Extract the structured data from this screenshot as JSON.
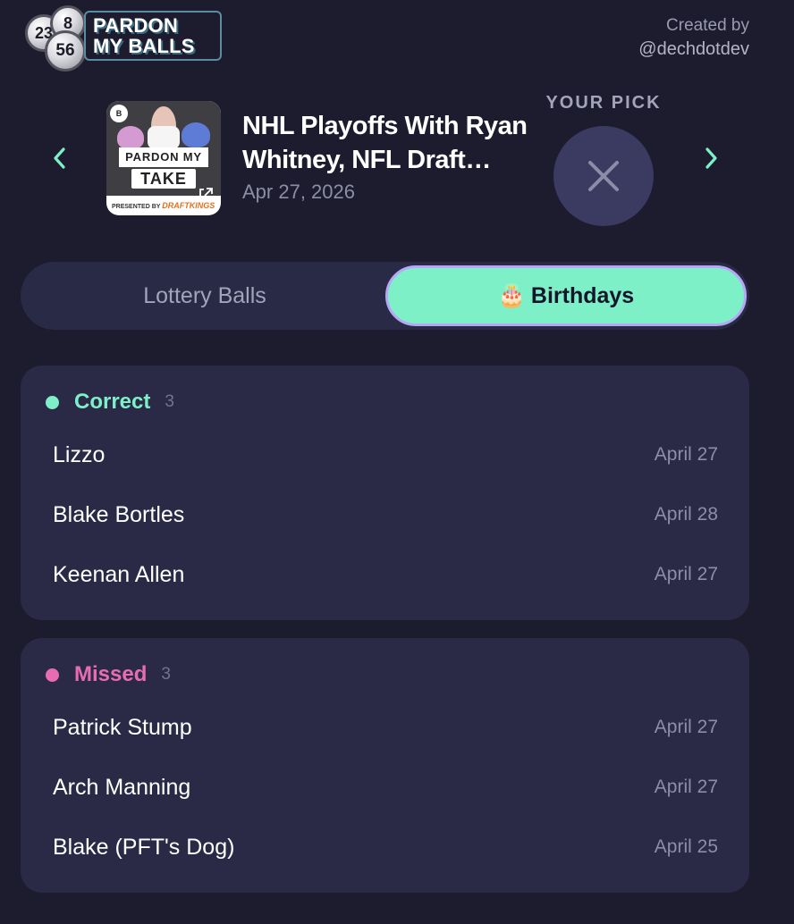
{
  "header": {
    "logo": {
      "balls": [
        "23",
        "8",
        "56"
      ],
      "line1": "PARDON",
      "line2": "MY BALLS"
    },
    "credit_label": "Created by",
    "credit_handle": "@dechdotdev"
  },
  "episode": {
    "title": "NHL Playoffs With Ryan Whitney, NFL Draft Recap",
    "date": "Apr 27, 2026",
    "cover": {
      "banner": "PARDON MY",
      "take": "TAKE",
      "presented_by": "PRESENTED BY",
      "sponsor": "DRAFTKINGS",
      "badge": "B"
    }
  },
  "pick": {
    "label": "YOUR PICK",
    "state_icon": "x-icon"
  },
  "tabs": {
    "lottery": "Lottery Balls",
    "birthdays": "Birthdays",
    "birthdays_emoji": "🎂",
    "active": "birthdays"
  },
  "correct": {
    "label": "Correct",
    "count": "3",
    "items": [
      {
        "name": "Lizzo",
        "date": "April 27"
      },
      {
        "name": "Blake Bortles",
        "date": "April 28"
      },
      {
        "name": "Keenan Allen",
        "date": "April 27"
      }
    ]
  },
  "missed": {
    "label": "Missed",
    "count": "3",
    "items": [
      {
        "name": "Patrick Stump",
        "date": "April 27"
      },
      {
        "name": "Arch Manning",
        "date": "April 27"
      },
      {
        "name": "Blake (PFT's Dog)",
        "date": "April 25"
      }
    ]
  },
  "colors": {
    "background": "#1c1c2e",
    "card": "#2a2a47",
    "accent_green": "#7ef0c8",
    "accent_pink": "#e76db3",
    "pick_circle": "#3b3a61"
  }
}
